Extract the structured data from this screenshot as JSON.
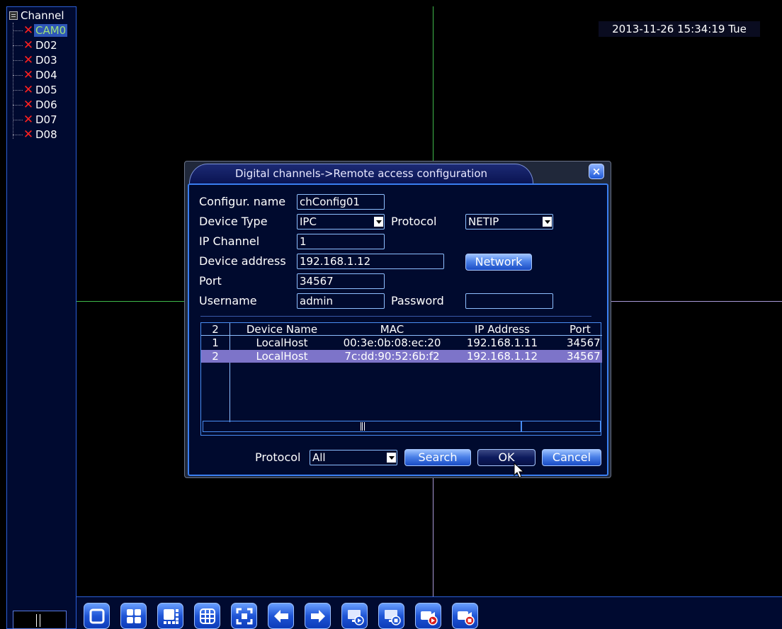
{
  "sidebar": {
    "header": "Channel",
    "items": [
      {
        "label": "CAM0",
        "selected": true
      },
      {
        "label": "D02"
      },
      {
        "label": "D03"
      },
      {
        "label": "D04"
      },
      {
        "label": "D05"
      },
      {
        "label": "D06"
      },
      {
        "label": "D07"
      },
      {
        "label": "D08"
      }
    ]
  },
  "overlay": {
    "timestamp": "2013-11-26 15:34:19 Tue"
  },
  "dialog": {
    "title": "Digital channels->Remote access configuration",
    "close_label": "×",
    "config_name_label": "Configur. name",
    "config_name_value": "chConfig01",
    "device_type_label": "Device Type",
    "device_type_value": "IPC",
    "protocol_label": "Protocol",
    "protocol_value": "NETIP",
    "ip_channel_label": "IP Channel",
    "ip_channel_value": "1",
    "device_address_label": "Device address",
    "device_address_value": "192.168.1.12",
    "network_button": "Network",
    "port_label": "Port",
    "port_value": "34567",
    "username_label": "Username",
    "username_value": "admin",
    "password_label": "Password",
    "password_value": "",
    "table": {
      "count": "2",
      "headers": [
        "Device Name",
        "MAC",
        "IP Address",
        "Port"
      ],
      "rows": [
        {
          "index": "1",
          "name": "LocalHost",
          "mac": "00:3e:0b:08:ec:20",
          "ip": "192.168.1.11",
          "port": "34567"
        },
        {
          "index": "2",
          "name": "LocalHost",
          "mac": "7c:dd:90:52:6b:f2",
          "ip": "192.168.1.12",
          "port": "34567",
          "selected": true
        }
      ]
    },
    "filter_protocol_label": "Protocol",
    "filter_protocol_value": "All",
    "search_button": "Search",
    "ok_button": "OK",
    "cancel_button": "Cancel"
  },
  "toolbar": {
    "buttons": [
      {
        "icon": "single-view-icon"
      },
      {
        "icon": "quad-view-icon"
      },
      {
        "icon": "eight-view-icon"
      },
      {
        "icon": "nine-view-icon"
      },
      {
        "icon": "fullscreen-icon"
      },
      {
        "icon": "arrow-left-icon"
      },
      {
        "icon": "arrow-right-icon"
      },
      {
        "icon": "playback-icon"
      },
      {
        "icon": "record-settings-icon"
      },
      {
        "icon": "record-start-icon"
      },
      {
        "icon": "record-stop-icon"
      }
    ]
  },
  "colors": {
    "accent": "#2c5fd9",
    "selection": "#7d74c9",
    "error_x": "#ff2020"
  }
}
